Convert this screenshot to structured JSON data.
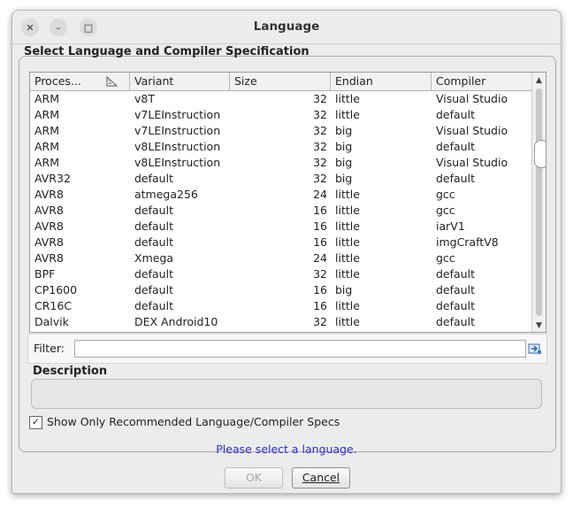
{
  "window": {
    "title": "Language",
    "close_glyph": "✕",
    "minimize_glyph": "–",
    "maximize_glyph": "□"
  },
  "panel": {
    "title": "Select Language and Compiler Specification"
  },
  "table": {
    "columns": [
      "Proces...",
      "Variant",
      "Size",
      "Endian",
      "Compiler"
    ],
    "rows": [
      [
        "ARM",
        "v8T",
        "32",
        "little",
        "Visual Studio"
      ],
      [
        "ARM",
        "v7LEInstruction",
        "32",
        "little",
        "default"
      ],
      [
        "ARM",
        "v7LEInstruction",
        "32",
        "big",
        "Visual Studio"
      ],
      [
        "ARM",
        "v8LEInstruction",
        "32",
        "big",
        "default"
      ],
      [
        "ARM",
        "v8LEInstruction",
        "32",
        "big",
        "Visual Studio"
      ],
      [
        "AVR32",
        "default",
        "32",
        "big",
        "default"
      ],
      [
        "AVR8",
        "atmega256",
        "24",
        "little",
        "gcc"
      ],
      [
        "AVR8",
        "default",
        "16",
        "little",
        "gcc"
      ],
      [
        "AVR8",
        "default",
        "16",
        "little",
        "iarV1"
      ],
      [
        "AVR8",
        "default",
        "16",
        "little",
        "imgCraftV8"
      ],
      [
        "AVR8",
        "Xmega",
        "24",
        "little",
        "gcc"
      ],
      [
        "BPF",
        "default",
        "32",
        "little",
        "default"
      ],
      [
        "CP1600",
        "default",
        "16",
        "big",
        "default"
      ],
      [
        "CR16C",
        "default",
        "16",
        "little",
        "default"
      ],
      [
        "Dalvik",
        "DEX Android10",
        "32",
        "little",
        "default"
      ]
    ]
  },
  "filter": {
    "label": "Filter:",
    "value": ""
  },
  "description": {
    "title": "Description",
    "text": ""
  },
  "recommended": {
    "label": "Show Only Recommended Language/Compiler Specs",
    "checked": true
  },
  "status": "Please select a language.",
  "buttons": {
    "ok": "OK",
    "cancel": "Cancel"
  }
}
